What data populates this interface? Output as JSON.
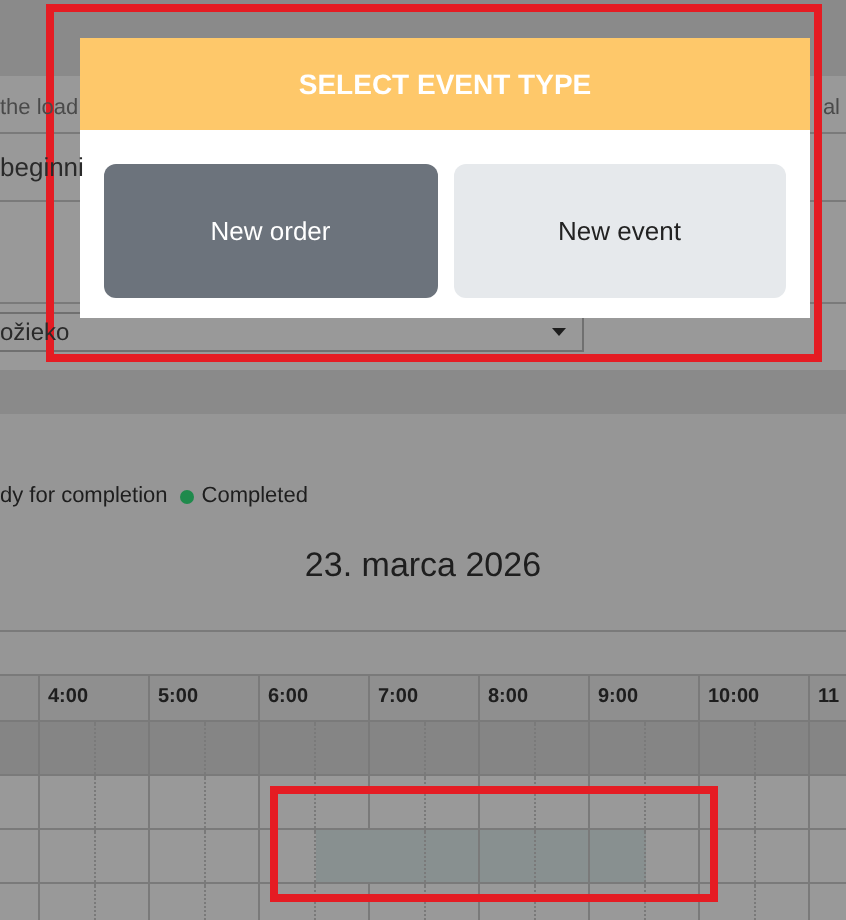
{
  "form": {
    "label_left": "the load",
    "label_right": "al",
    "field_value": "beginni",
    "select_value": "ožieko"
  },
  "legend": [
    {
      "label": "dy for completion"
    },
    {
      "label": "Completed",
      "color": "#1f8a4c"
    }
  ],
  "date_title": "23. marca 2026",
  "timeline": {
    "hours": [
      "4:00",
      "5:00",
      "6:00",
      "7:00",
      "8:00",
      "9:00",
      "10:00",
      "11"
    ]
  },
  "modal": {
    "title": "SELECT EVENT TYPE",
    "options": [
      {
        "label": "New order",
        "selected": true
      },
      {
        "label": "New event",
        "selected": false
      }
    ]
  }
}
